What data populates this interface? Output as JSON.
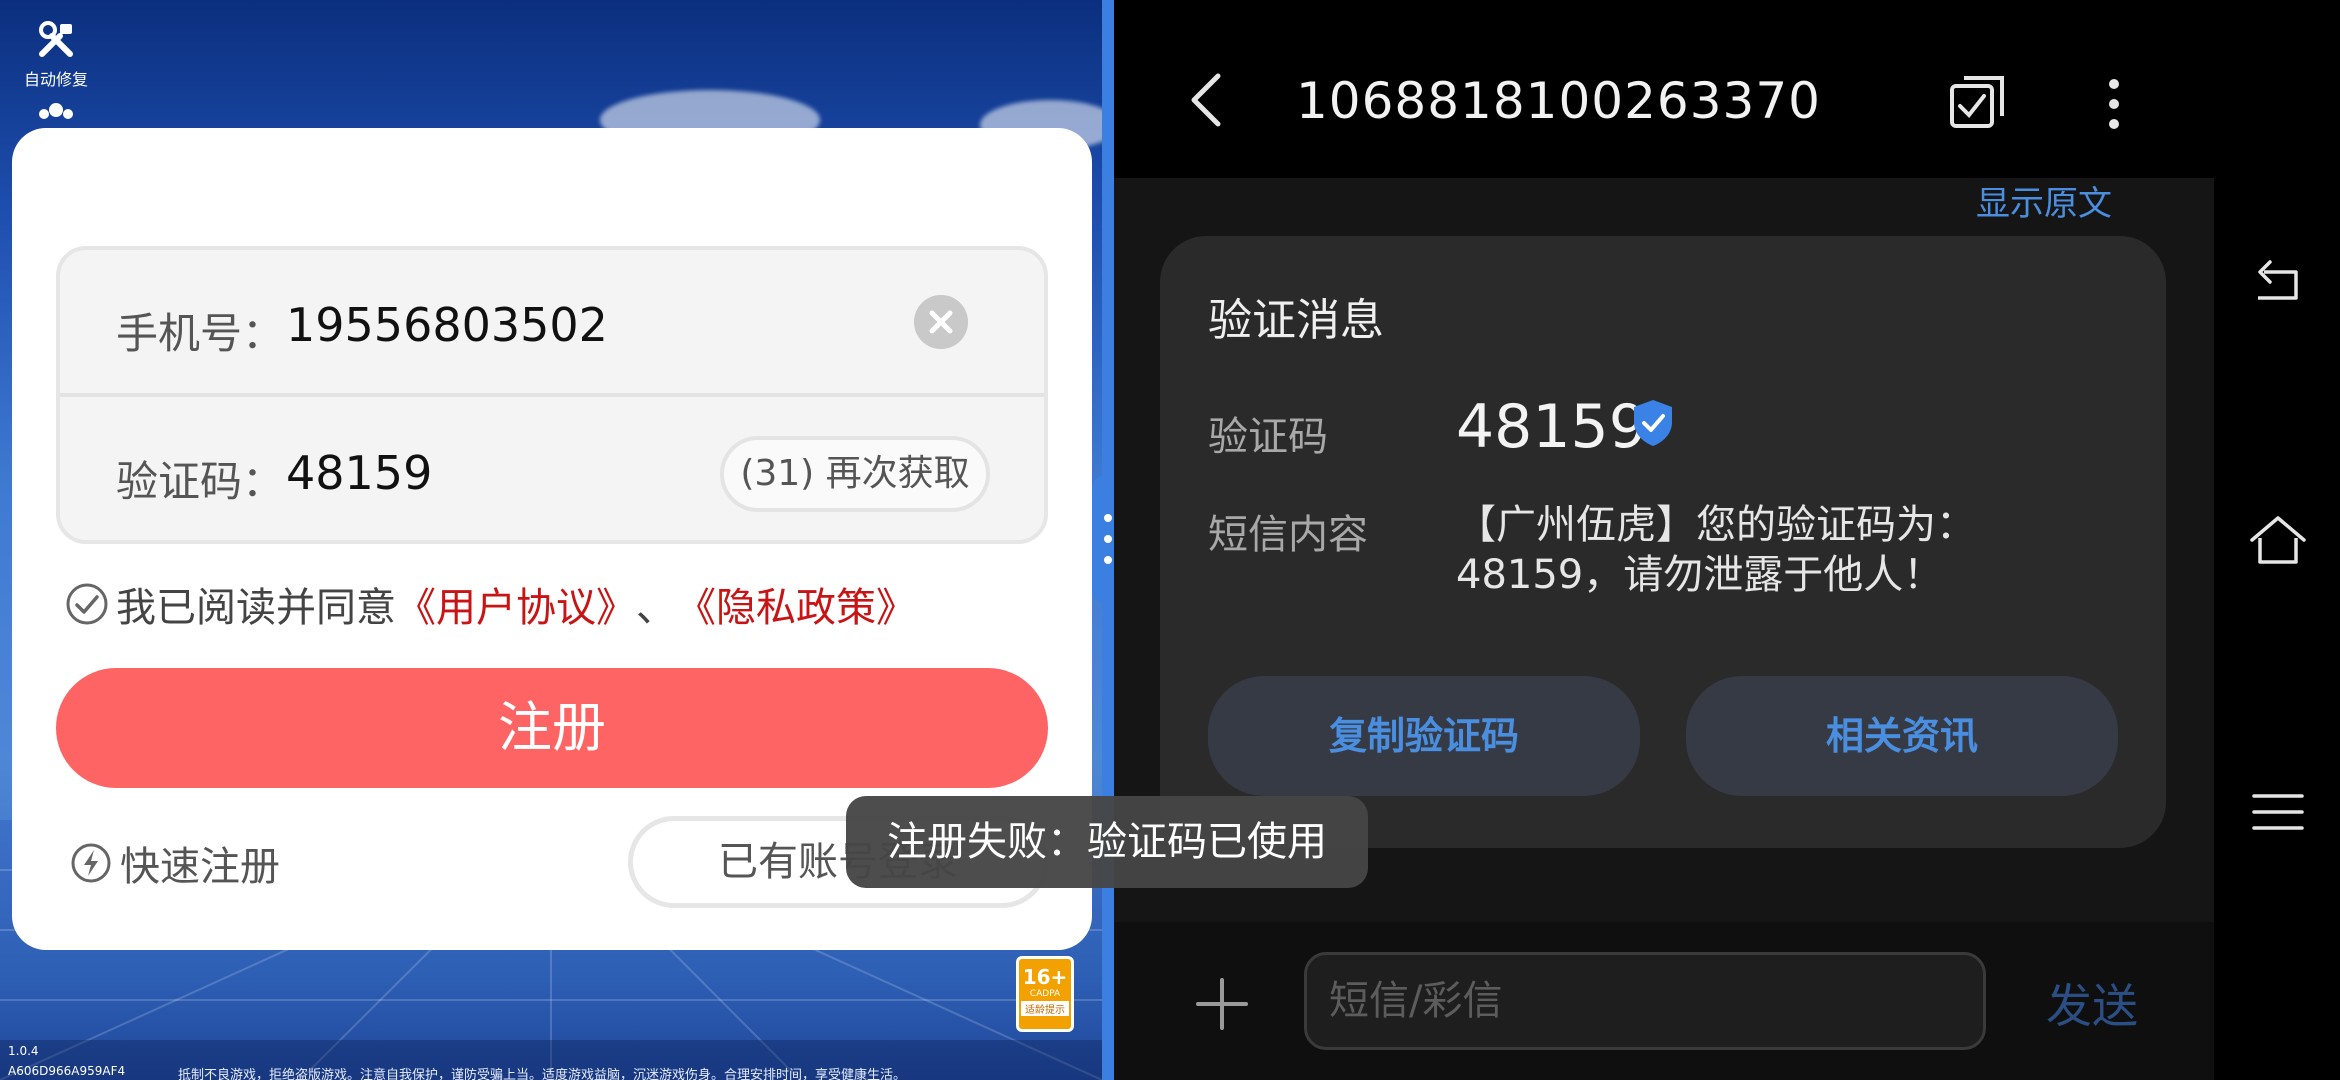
{
  "game": {
    "auto_repair_label": "自动修复",
    "phone_label": "手机号：",
    "phone_value": "19556803502",
    "code_label": "验证码：",
    "code_value": "48159",
    "resend_label": "(31) 再次获取",
    "agree_prefix": "我已阅读并同意",
    "user_agreement": "《用户协议》",
    "separator": "、",
    "privacy_policy": "《隐私政策》",
    "register_label": "注册",
    "quick_register_label": "快速注册",
    "login_label": "已有账号登录",
    "age_rating": "16+",
    "age_org": "CADPA",
    "age_tip": "适龄提示",
    "version": "1.0.4",
    "device_id": "A606D966A959AF4",
    "health_notice": "抵制不良游戏，拒绝盗版游戏。注意自我保护，谨防受骗上当。适度游戏益脑，沉迷游戏伤身。合理安排时间，享受健康生活。"
  },
  "toast": {
    "message": "注册失败：验证码已使用"
  },
  "sms": {
    "sender": "1068818100263370",
    "show_original": "显示原文",
    "card_title": "验证消息",
    "code_label": "验证码",
    "code_value": "48159",
    "content_label": "短信内容",
    "content_value": "【广州伍虎】您的验证码为：48159，请勿泄露于他人！",
    "copy_code_button": "复制验证码",
    "related_info_button": "相关资讯",
    "input_placeholder": "短信/彩信",
    "send_button": "发送"
  },
  "colors": {
    "accent_red": "#ff6464",
    "link_red": "#c81414",
    "sms_accent_blue": "#4a8ee0",
    "divider_blue": "#3b7fe0"
  },
  "icons": [
    "tools-icon",
    "users-icon",
    "clear-icon",
    "checkmark-circle-icon",
    "lightning-icon",
    "back-arrow-icon",
    "multi-select-icon",
    "more-vertical-icon",
    "verified-shield-icon",
    "plus-icon",
    "nav-back-icon",
    "nav-home-icon",
    "nav-menu-icon"
  ]
}
